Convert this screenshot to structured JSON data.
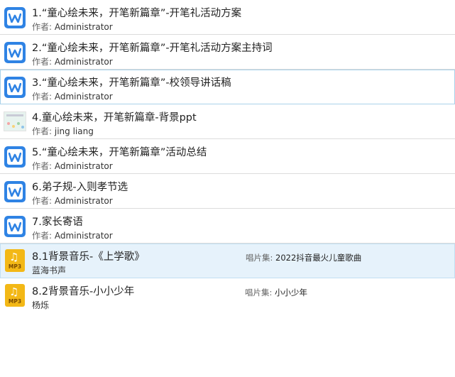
{
  "files": [
    {
      "title": "1.“童心绘未来，开笔新篇章”-开笔礼活动方案",
      "author_label": "作者:",
      "author": "Administrator",
      "icon": "wps-writer-icon"
    },
    {
      "title": "2.“童心绘未来，开笔新篇章”-开笔礼活动方案主持词",
      "author_label": "作者:",
      "author": "Administrator",
      "icon": "wps-writer-icon"
    },
    {
      "title": "3.“童心绘未来，开笔新篇章”-校领导讲话稿",
      "author_label": "作者:",
      "author": "Administrator",
      "icon": "wps-writer-icon"
    },
    {
      "title": "4.童心绘未来，开笔新篇章-背景ppt",
      "author_label": "作者:",
      "author": "jing liang",
      "icon": "ppt-thumbnail-icon"
    },
    {
      "title": "5.“童心绘未来，开笔新篇章”活动总结",
      "author_label": "作者:",
      "author": "Administrator",
      "icon": "wps-writer-icon"
    },
    {
      "title": "6.弟子规-入则孝节选",
      "author_label": "作者:",
      "author": "Administrator",
      "icon": "wps-writer-icon"
    },
    {
      "title": "7.家长寄语",
      "author_label": "作者:",
      "author": "Administrator",
      "icon": "wps-writer-icon"
    },
    {
      "title": "8.1背景音乐-《上学歌》",
      "artist": "蓝海书声",
      "album_label": "唱片集:",
      "album": "2022抖音最火儿童歌曲",
      "icon": "mp3-file-icon",
      "icon_tag": "MP3"
    },
    {
      "title": "8.2背景音乐-小小少年",
      "artist": "杨烁",
      "album_label": "唱片集:",
      "album": "小小少年",
      "icon": "mp3-file-icon",
      "icon_tag": "MP3"
    }
  ],
  "colors": {
    "wps_blue": "#2f83e4",
    "mp3_yellow": "#f3b816",
    "selected_bg": "#e6f2fb",
    "hover_border": "#a9d2ea"
  }
}
